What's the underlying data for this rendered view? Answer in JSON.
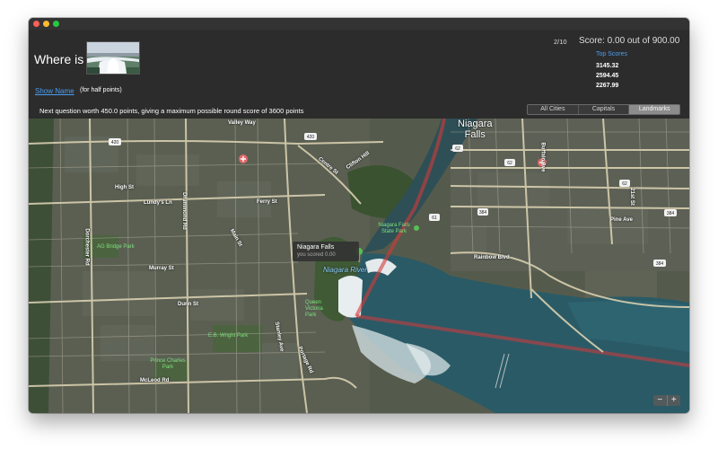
{
  "question": {
    "label": "Where is",
    "image_alt": "Niagara Falls photo",
    "show_name_link": "Show Name",
    "show_name_note": "(for half points)",
    "next_question_text": "Next question worth 450.0 points, giving a maximum possible round score of 3600 points"
  },
  "progress": "2/10",
  "score_text": "Score: 0.00 out of 900.00",
  "top_scores": {
    "title": "Top Scores",
    "values": [
      "3145.32",
      "2594.45",
      "2267.99"
    ]
  },
  "categories": {
    "items": [
      "All Cities",
      "Capitals",
      "Landmarks"
    ],
    "selected": "Landmarks"
  },
  "map": {
    "callout": {
      "title": "Niagara Falls",
      "subtitle": "you scored 0.00"
    },
    "labels": {
      "city": "Niagara\nFalls",
      "streets": [
        "Valley Way",
        "High St",
        "Lundy's Ln",
        "Ferry St",
        "Murray St",
        "Dunn St",
        "McLeod Rd",
        "Main St",
        "Drummond Rd",
        "Dorchester Rd",
        "Stanley Ave",
        "Portage Rd",
        "Centre St",
        "Clifton Hill",
        "Rainbow Blvd",
        "Buffalo Ave",
        "Pine Ave",
        "21st St"
      ],
      "parks": [
        "Niagara Falls State Park",
        "AG Bridge Park",
        "Queen Victoria Park",
        "E.B. Wright Park",
        "Prince Charles Park"
      ],
      "water": "Niagara River",
      "shields": [
        "420",
        "420",
        "62",
        "62",
        "62",
        "61",
        "384",
        "384",
        "384"
      ]
    },
    "zoom": {
      "minus": "−",
      "plus": "+"
    }
  },
  "colors": {
    "accent": "#4a9df0",
    "route_line": "#d23a3a",
    "river": "#2a5a66",
    "close": "#fe5f57",
    "minimize": "#febc2e",
    "maximize": "#28c840"
  },
  "icons": {
    "pin": "map-pin-icon",
    "hospital": "hospital-icon"
  }
}
